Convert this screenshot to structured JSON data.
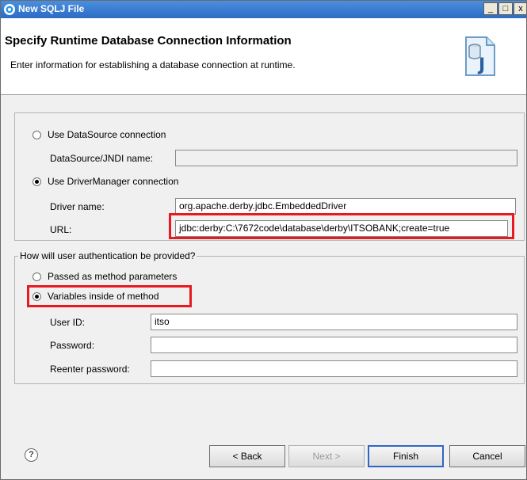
{
  "window": {
    "title": "New SQLJ File",
    "minimize": "_",
    "maximize": "□",
    "close": "x"
  },
  "header": {
    "title": "Specify Runtime Database Connection Information",
    "description": "Enter information for establishing a database connection at runtime.",
    "graphic_letter": "J"
  },
  "connection": {
    "datasource_option": "Use DataSource connection",
    "datasource_selected": false,
    "jndi_label": "DataSource/JNDI name:",
    "jndi_value": "",
    "drivermanager_option": "Use DriverManager connection",
    "drivermanager_selected": true,
    "driver_label": "Driver name:",
    "driver_value": "org.apache.derby.jdbc.EmbeddedDriver",
    "url_label": "URL:",
    "url_value": "jdbc:derby:C:\\7672code\\database\\derby\\ITSOBANK;create=true"
  },
  "authentication": {
    "legend": "How will user authentication be provided?",
    "method_params_option": "Passed as method parameters",
    "method_params_selected": false,
    "variables_option": "Variables inside of method",
    "variables_selected": true,
    "userid_label": "User ID:",
    "userid_value": "itso",
    "password_label": "Password:",
    "password_value": "",
    "reenter_label": "Reenter password:",
    "reenter_value": ""
  },
  "footer": {
    "help_icon": "?",
    "back": "< Back",
    "next": "Next >",
    "finish": "Finish",
    "cancel": "Cancel"
  },
  "colors": {
    "highlight": "#e8191f",
    "titlebar": "#2b6cc4"
  }
}
